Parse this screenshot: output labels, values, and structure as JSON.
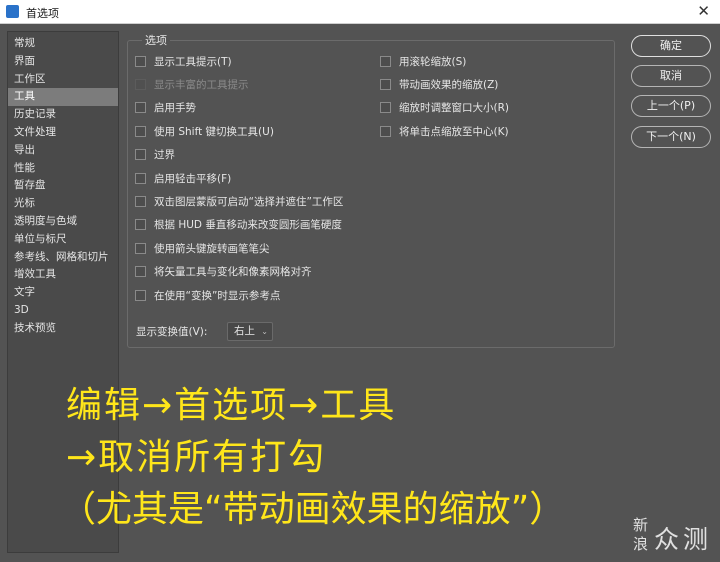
{
  "window": {
    "title": "首选项",
    "close_glyph": "✕"
  },
  "sidebar": {
    "items": [
      {
        "label": "常规"
      },
      {
        "label": "界面"
      },
      {
        "label": "工作区"
      },
      {
        "label": "工具",
        "selected": true
      },
      {
        "label": "历史记录"
      },
      {
        "label": "文件处理"
      },
      {
        "label": "导出"
      },
      {
        "label": "性能"
      },
      {
        "label": "暂存盘"
      },
      {
        "label": "光标"
      },
      {
        "label": "透明度与色域"
      },
      {
        "label": "单位与标尺"
      },
      {
        "label": "参考线、网格和切片"
      },
      {
        "label": "增效工具"
      },
      {
        "label": "文字"
      },
      {
        "label": "3D"
      },
      {
        "label": "技术预览"
      }
    ]
  },
  "options": {
    "legend": "选项",
    "left_checkboxes": [
      {
        "label": "显示工具提示(T)",
        "checked": false,
        "enabled": true
      },
      {
        "label": "显示丰富的工具提示",
        "checked": false,
        "enabled": false
      },
      {
        "label": "启用手势",
        "checked": false,
        "enabled": true
      },
      {
        "label": "使用 Shift 键切换工具(U)",
        "checked": false,
        "enabled": true
      },
      {
        "label": "过界",
        "checked": false,
        "enabled": true
      },
      {
        "label": "启用轻击平移(F)",
        "checked": false,
        "enabled": true
      },
      {
        "label": "双击图层蒙版可启动“选择并遮住”工作区",
        "checked": false,
        "enabled": true
      },
      {
        "label": "根据 HUD 垂直移动来改变圆形画笔硬度",
        "checked": false,
        "enabled": true
      },
      {
        "label": "使用箭头键旋转画笔笔尖",
        "checked": false,
        "enabled": true
      },
      {
        "label": "将矢量工具与变化和像素网格对齐",
        "checked": false,
        "enabled": true
      },
      {
        "label": "在使用“变换”时显示参考点",
        "checked": false,
        "enabled": true
      }
    ],
    "right_checkboxes": [
      {
        "label": "用滚轮缩放(S)",
        "checked": false,
        "enabled": true
      },
      {
        "label": "带动画效果的缩放(Z)",
        "checked": false,
        "enabled": true
      },
      {
        "label": "缩放时调整窗口大小(R)",
        "checked": false,
        "enabled": true
      },
      {
        "label": "将单击点缩放至中心(K)",
        "checked": false,
        "enabled": true
      }
    ],
    "transform_values": {
      "label": "显示变换值(V):",
      "selected": "右上",
      "caret": "⌄"
    }
  },
  "buttons": {
    "ok": "确定",
    "cancel": "取消",
    "prev": "上一个(P)",
    "next": "下一个(N)"
  },
  "annotation": {
    "line1": "编辑→首选项→工具",
    "line2": "→取消所有打勾",
    "line3": "（尤其是“带动画效果的缩放”）"
  },
  "watermark": {
    "char1": "新",
    "char2": "浪",
    "char3": "众",
    "char4": "测"
  },
  "colors": {
    "dialog_bg": "#535353",
    "selected_item": "#7c7c7c",
    "annotation": "#ffe61a"
  }
}
